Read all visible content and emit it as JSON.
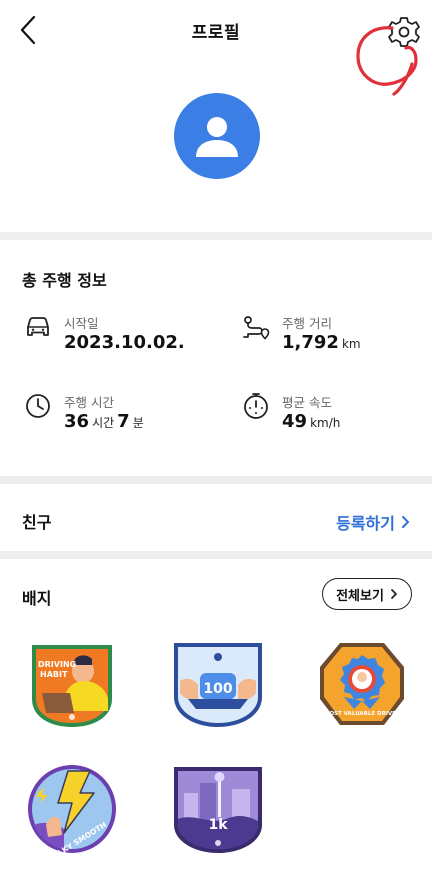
{
  "header": {
    "title": "프로필",
    "back_icon": "chevron-left-icon",
    "settings_icon": "gear-icon"
  },
  "profile": {
    "avatar_icon": "person-icon",
    "avatar_color": "#3b7ee6"
  },
  "driving_info": {
    "title": "총 주행 정보",
    "stats": [
      {
        "icon": "car-icon",
        "label": "시작일",
        "value": "2023.10.02.",
        "unit": ""
      },
      {
        "icon": "route-icon",
        "label": "주행 거리",
        "value": "1,792",
        "unit": "km"
      },
      {
        "icon": "clock-icon",
        "label": "주행 시간",
        "value_hours": "36",
        "unit_hours": "시간",
        "value_minutes": "7",
        "unit_minutes": "분"
      },
      {
        "icon": "speedometer-icon",
        "label": "평균 속도",
        "value": "49",
        "unit": "km/h"
      }
    ]
  },
  "friends": {
    "title": "친구",
    "register_label": "등록하기"
  },
  "badges": {
    "title": "배지",
    "view_all_label": "전체보기",
    "items": [
      {
        "name": "driving-habit-badge",
        "text": "DRIVING HABIT"
      },
      {
        "name": "100-badge",
        "text": "100"
      },
      {
        "name": "most-valuable-driver-badge",
        "text": "MOST VALUABLE DRIVER"
      },
      {
        "name": "silky-smooth-badge",
        "text": "SILKY SMOOTH"
      },
      {
        "name": "1k-badge",
        "text": "1k"
      }
    ]
  },
  "colors": {
    "accent": "#2f6fd8",
    "divider": "#eeeeee"
  }
}
